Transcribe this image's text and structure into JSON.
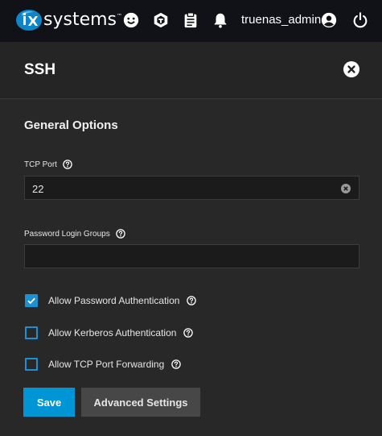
{
  "topbar": {
    "logo_text": "systems",
    "logo_tm": "™",
    "username": "truenas_admin",
    "icons": [
      "feedback-smile-icon",
      "truecommand-icon",
      "jobs-clipboard-icon",
      "notifications-bell-icon",
      "account-circle-icon",
      "power-icon"
    ]
  },
  "header": {
    "title": "SSH",
    "close_icon": "close-circle-icon"
  },
  "form": {
    "section_title": "General Options",
    "tcp_port": {
      "label": "TCP Port",
      "value": "22"
    },
    "password_login_groups": {
      "label": "Password Login Groups",
      "value": ""
    },
    "checkboxes": [
      {
        "label": "Allow Password Authentication",
        "checked": true
      },
      {
        "label": "Allow Kerberos Authentication",
        "checked": false
      },
      {
        "label": "Allow TCP Port Forwarding",
        "checked": false
      }
    ]
  },
  "actions": {
    "save_label": "Save",
    "advanced_label": "Advanced Settings"
  },
  "colors": {
    "accent": "#0095d5",
    "topbar": "#111217",
    "background": "#282828"
  }
}
